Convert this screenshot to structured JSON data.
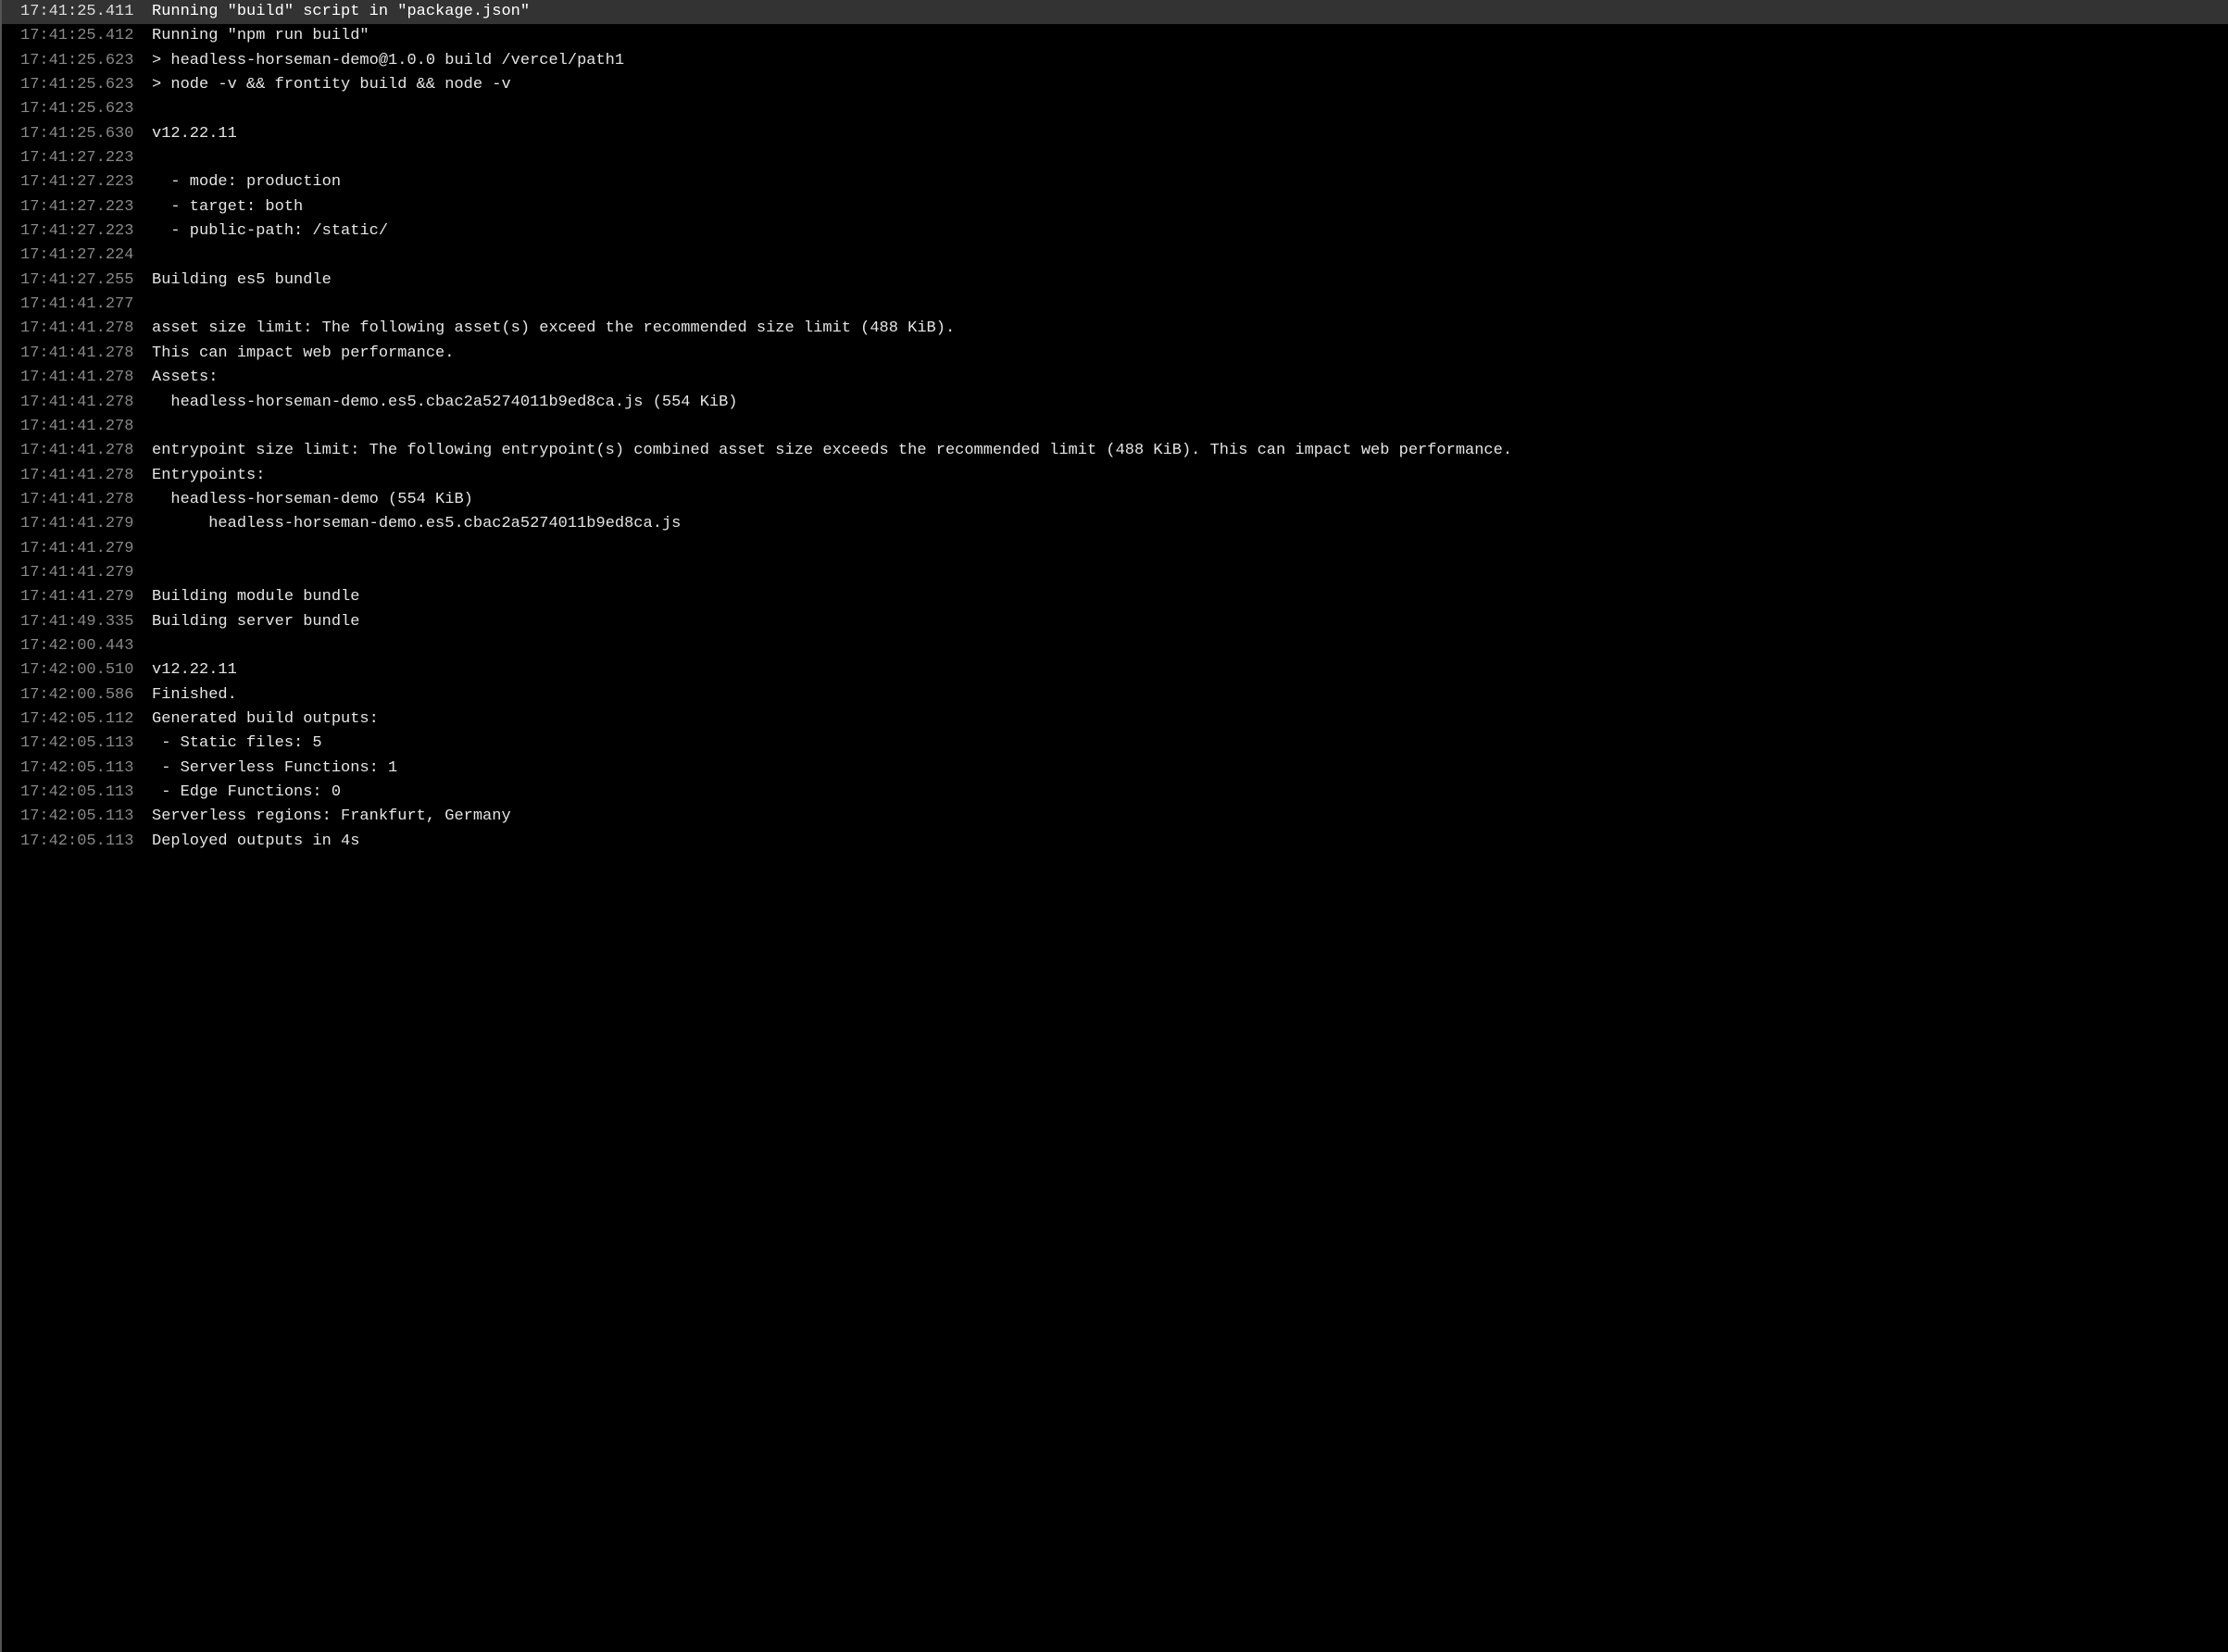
{
  "log": {
    "lines": [
      {
        "ts": "17:41:25.411",
        "msg": "Running \"build\" script in \"package.json\"",
        "highlighted": true
      },
      {
        "ts": "17:41:25.412",
        "msg": "Running \"npm run build\""
      },
      {
        "ts": "17:41:25.623",
        "msg": "> headless-horseman-demo@1.0.0 build /vercel/path1"
      },
      {
        "ts": "17:41:25.623",
        "msg": "> node -v && frontity build && node -v"
      },
      {
        "ts": "17:41:25.623",
        "msg": ""
      },
      {
        "ts": "17:41:25.630",
        "msg": "v12.22.11"
      },
      {
        "ts": "17:41:27.223",
        "msg": ""
      },
      {
        "ts": "17:41:27.223",
        "msg": "  - mode: production"
      },
      {
        "ts": "17:41:27.223",
        "msg": "  - target: both"
      },
      {
        "ts": "17:41:27.223",
        "msg": "  - public-path: /static/"
      },
      {
        "ts": "17:41:27.224",
        "msg": ""
      },
      {
        "ts": "17:41:27.255",
        "msg": "Building es5 bundle"
      },
      {
        "ts": "17:41:41.277",
        "msg": ""
      },
      {
        "ts": "17:41:41.278",
        "msg": "asset size limit: The following asset(s) exceed the recommended size limit (488 KiB)."
      },
      {
        "ts": "17:41:41.278",
        "msg": "This can impact web performance."
      },
      {
        "ts": "17:41:41.278",
        "msg": "Assets:"
      },
      {
        "ts": "17:41:41.278",
        "msg": "  headless-horseman-demo.es5.cbac2a5274011b9ed8ca.js (554 KiB)"
      },
      {
        "ts": "17:41:41.278",
        "msg": ""
      },
      {
        "ts": "17:41:41.278",
        "msg": "entrypoint size limit: The following entrypoint(s) combined asset size exceeds the recommended limit (488 KiB). This can impact web performance."
      },
      {
        "ts": "17:41:41.278",
        "msg": "Entrypoints:"
      },
      {
        "ts": "17:41:41.278",
        "msg": "  headless-horseman-demo (554 KiB)"
      },
      {
        "ts": "17:41:41.279",
        "msg": "      headless-horseman-demo.es5.cbac2a5274011b9ed8ca.js"
      },
      {
        "ts": "17:41:41.279",
        "msg": ""
      },
      {
        "ts": "17:41:41.279",
        "msg": ""
      },
      {
        "ts": "17:41:41.279",
        "msg": "Building module bundle"
      },
      {
        "ts": "17:41:49.335",
        "msg": "Building server bundle"
      },
      {
        "ts": "17:42:00.443",
        "msg": ""
      },
      {
        "ts": "17:42:00.510",
        "msg": "v12.22.11"
      },
      {
        "ts": "17:42:00.586",
        "msg": "Finished."
      },
      {
        "ts": "17:42:05.112",
        "msg": "Generated build outputs:"
      },
      {
        "ts": "17:42:05.113",
        "msg": " - Static files: 5"
      },
      {
        "ts": "17:42:05.113",
        "msg": " - Serverless Functions: 1"
      },
      {
        "ts": "17:42:05.113",
        "msg": " - Edge Functions: 0"
      },
      {
        "ts": "17:42:05.113",
        "msg": "Serverless regions: Frankfurt, Germany"
      },
      {
        "ts": "17:42:05.113",
        "msg": "Deployed outputs in 4s"
      }
    ]
  }
}
